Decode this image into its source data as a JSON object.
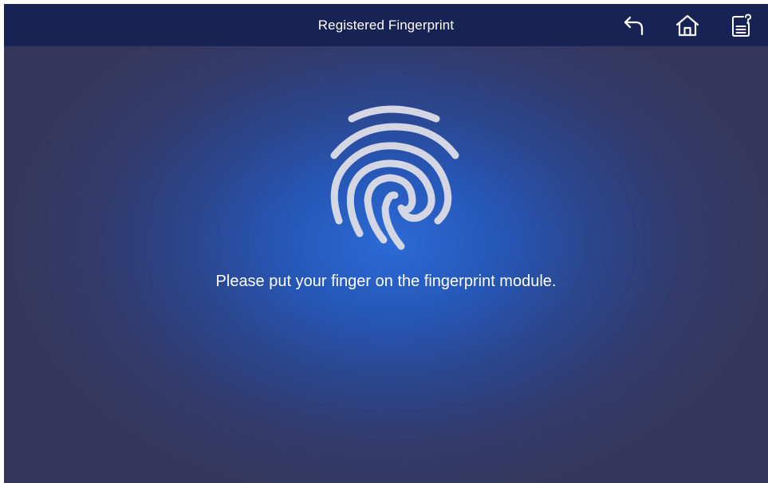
{
  "header": {
    "title": "Registered Fingerprint",
    "icons": {
      "back": "back-arrow-icon",
      "home": "home-icon",
      "menu": "document-help-icon"
    }
  },
  "main": {
    "prompt": "Please put your finger on the fingerprint module.",
    "fingerprint_icon": "fingerprint-icon"
  },
  "colors": {
    "header_bg": "#172354",
    "glow_center": "#2b6ad6",
    "background_edge": "#35375a",
    "fingerprint_stroke": "#d4d6e4",
    "text": "#ffffff"
  }
}
